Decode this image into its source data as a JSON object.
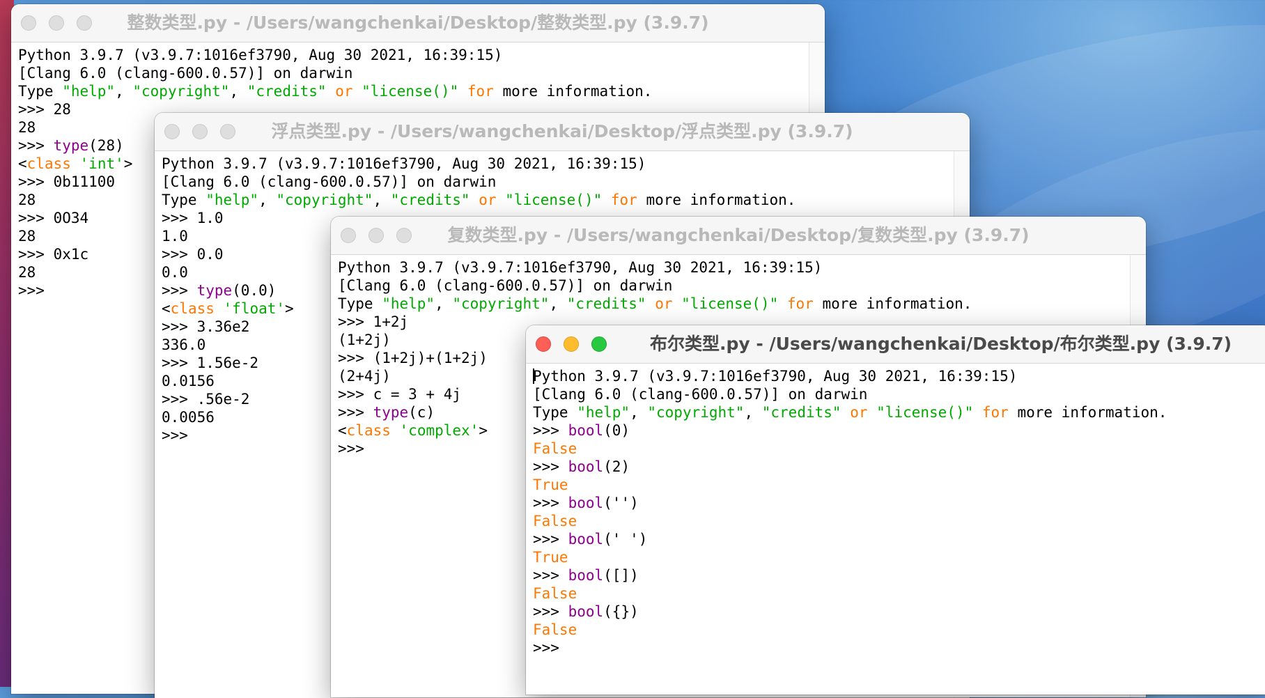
{
  "windows": [
    {
      "title": "整数类型.py - /Users/wangchenkai/Desktop/整数类型.py (3.9.7)",
      "lines": [
        [
          {
            "t": "Python 3.9.7 (v3.9.7:1016ef3790, Aug 30 2021, 16:39:15)",
            "c": ""
          }
        ],
        [
          {
            "t": "[Clang 6.0 (clang-600.0.57)] on darwin",
            "c": ""
          }
        ],
        [
          {
            "t": "Type ",
            "c": ""
          },
          {
            "t": "\"help\"",
            "c": "str"
          },
          {
            "t": ", ",
            "c": ""
          },
          {
            "t": "\"copyright\"",
            "c": "str"
          },
          {
            "t": ", ",
            "c": ""
          },
          {
            "t": "\"credits\"",
            "c": "str"
          },
          {
            "t": " ",
            "c": ""
          },
          {
            "t": "or",
            "c": "kw"
          },
          {
            "t": " ",
            "c": ""
          },
          {
            "t": "\"license()\"",
            "c": "str"
          },
          {
            "t": " ",
            "c": ""
          },
          {
            "t": "for",
            "c": "kw"
          },
          {
            "t": " more information.",
            "c": ""
          }
        ],
        [
          {
            "t": ">>> 28",
            "c": ""
          }
        ],
        [
          {
            "t": "28",
            "c": ""
          }
        ],
        [
          {
            "t": ">>> ",
            "c": ""
          },
          {
            "t": "type",
            "c": "bi"
          },
          {
            "t": "(28)",
            "c": ""
          }
        ],
        [
          {
            "t": "<",
            "c": ""
          },
          {
            "t": "class",
            "c": "kw"
          },
          {
            "t": " ",
            "c": ""
          },
          {
            "t": "'int'",
            "c": "str"
          },
          {
            "t": ">",
            "c": ""
          }
        ],
        [
          {
            "t": ">>> 0b11100",
            "c": ""
          }
        ],
        [
          {
            "t": "28",
            "c": ""
          }
        ],
        [
          {
            "t": ">>> 0O34",
            "c": ""
          }
        ],
        [
          {
            "t": "28",
            "c": ""
          }
        ],
        [
          {
            "t": ">>> 0x1c",
            "c": ""
          }
        ],
        [
          {
            "t": "28",
            "c": ""
          }
        ],
        [
          {
            "t": ">>>",
            "c": ""
          }
        ]
      ]
    },
    {
      "title": "浮点类型.py - /Users/wangchenkai/Desktop/浮点类型.py (3.9.7)",
      "lines": [
        [
          {
            "t": "Python 3.9.7 (v3.9.7:1016ef3790, Aug 30 2021, 16:39:15)",
            "c": ""
          }
        ],
        [
          {
            "t": "[Clang 6.0 (clang-600.0.57)] on darwin",
            "c": ""
          }
        ],
        [
          {
            "t": "Type ",
            "c": ""
          },
          {
            "t": "\"help\"",
            "c": "str"
          },
          {
            "t": ", ",
            "c": ""
          },
          {
            "t": "\"copyright\"",
            "c": "str"
          },
          {
            "t": ", ",
            "c": ""
          },
          {
            "t": "\"credits\"",
            "c": "str"
          },
          {
            "t": " ",
            "c": ""
          },
          {
            "t": "or",
            "c": "kw"
          },
          {
            "t": " ",
            "c": ""
          },
          {
            "t": "\"license()\"",
            "c": "str"
          },
          {
            "t": " ",
            "c": ""
          },
          {
            "t": "for",
            "c": "kw"
          },
          {
            "t": " more information.",
            "c": ""
          }
        ],
        [
          {
            "t": ">>> 1.0",
            "c": ""
          }
        ],
        [
          {
            "t": "1.0",
            "c": ""
          }
        ],
        [
          {
            "t": ">>> 0.0",
            "c": ""
          }
        ],
        [
          {
            "t": "0.0",
            "c": ""
          }
        ],
        [
          {
            "t": ">>> ",
            "c": ""
          },
          {
            "t": "type",
            "c": "bi"
          },
          {
            "t": "(0.0)",
            "c": ""
          }
        ],
        [
          {
            "t": "<",
            "c": ""
          },
          {
            "t": "class",
            "c": "kw"
          },
          {
            "t": " ",
            "c": ""
          },
          {
            "t": "'float'",
            "c": "str"
          },
          {
            "t": ">",
            "c": ""
          }
        ],
        [
          {
            "t": ">>> 3.36e2",
            "c": ""
          }
        ],
        [
          {
            "t": "336.0",
            "c": ""
          }
        ],
        [
          {
            "t": ">>> 1.56e-2",
            "c": ""
          }
        ],
        [
          {
            "t": "0.0156",
            "c": ""
          }
        ],
        [
          {
            "t": ">>> .56e-2",
            "c": ""
          }
        ],
        [
          {
            "t": "0.0056",
            "c": ""
          }
        ],
        [
          {
            "t": ">>>",
            "c": ""
          }
        ]
      ]
    },
    {
      "title": "复数类型.py - /Users/wangchenkai/Desktop/复数类型.py (3.9.7)",
      "lines": [
        [
          {
            "t": "Python 3.9.7 (v3.9.7:1016ef3790, Aug 30 2021, 16:39:15)",
            "c": ""
          }
        ],
        [
          {
            "t": "[Clang 6.0 (clang-600.0.57)] on darwin",
            "c": ""
          }
        ],
        [
          {
            "t": "Type ",
            "c": ""
          },
          {
            "t": "\"help\"",
            "c": "str"
          },
          {
            "t": ", ",
            "c": ""
          },
          {
            "t": "\"copyright\"",
            "c": "str"
          },
          {
            "t": ", ",
            "c": ""
          },
          {
            "t": "\"credits\"",
            "c": "str"
          },
          {
            "t": " ",
            "c": ""
          },
          {
            "t": "or",
            "c": "kw"
          },
          {
            "t": " ",
            "c": ""
          },
          {
            "t": "\"license()\"",
            "c": "str"
          },
          {
            "t": " ",
            "c": ""
          },
          {
            "t": "for",
            "c": "kw"
          },
          {
            "t": " more information.",
            "c": ""
          }
        ],
        [
          {
            "t": ">>> 1+2j",
            "c": ""
          }
        ],
        [
          {
            "t": "(1+2j)",
            "c": ""
          }
        ],
        [
          {
            "t": ">>> (1+2j)+(1+2j)",
            "c": ""
          }
        ],
        [
          {
            "t": "(2+4j)",
            "c": ""
          }
        ],
        [
          {
            "t": ">>> c = 3 + 4j",
            "c": ""
          }
        ],
        [
          {
            "t": ">>> ",
            "c": ""
          },
          {
            "t": "type",
            "c": "bi"
          },
          {
            "t": "(c)",
            "c": ""
          }
        ],
        [
          {
            "t": "<",
            "c": ""
          },
          {
            "t": "class",
            "c": "kw"
          },
          {
            "t": " ",
            "c": ""
          },
          {
            "t": "'complex'",
            "c": "str"
          },
          {
            "t": ">",
            "c": ""
          }
        ],
        [
          {
            "t": ">>>",
            "c": ""
          }
        ]
      ]
    },
    {
      "title": "布尔类型.py - /Users/wangchenkai/Desktop/布尔类型.py (3.9.7)",
      "lines": [
        [
          {
            "t": "Python 3.9.7 (v3.9.7:1016ef3790, Aug 30 2021, 16:39:15)",
            "c": ""
          }
        ],
        [
          {
            "t": "[Clang 6.0 (clang-600.0.57)] on darwin",
            "c": ""
          }
        ],
        [
          {
            "t": "Type ",
            "c": ""
          },
          {
            "t": "\"help\"",
            "c": "str"
          },
          {
            "t": ", ",
            "c": ""
          },
          {
            "t": "\"copyright\"",
            "c": "str"
          },
          {
            "t": ", ",
            "c": ""
          },
          {
            "t": "\"credits\"",
            "c": "str"
          },
          {
            "t": " ",
            "c": ""
          },
          {
            "t": "or",
            "c": "kw"
          },
          {
            "t": " ",
            "c": ""
          },
          {
            "t": "\"license()\"",
            "c": "str"
          },
          {
            "t": " ",
            "c": ""
          },
          {
            "t": "for",
            "c": "kw"
          },
          {
            "t": " more information.",
            "c": ""
          }
        ],
        [
          {
            "t": ">>> ",
            "c": ""
          },
          {
            "t": "bool",
            "c": "bi"
          },
          {
            "t": "(0)",
            "c": ""
          }
        ],
        [
          {
            "t": "False",
            "c": "out"
          }
        ],
        [
          {
            "t": ">>> ",
            "c": ""
          },
          {
            "t": "bool",
            "c": "bi"
          },
          {
            "t": "(2)",
            "c": ""
          }
        ],
        [
          {
            "t": "True",
            "c": "out"
          }
        ],
        [
          {
            "t": ">>> ",
            "c": ""
          },
          {
            "t": "bool",
            "c": "bi"
          },
          {
            "t": "('')",
            "c": ""
          }
        ],
        [
          {
            "t": "False",
            "c": "out"
          }
        ],
        [
          {
            "t": ">>> ",
            "c": ""
          },
          {
            "t": "bool",
            "c": "bi"
          },
          {
            "t": "(' ')",
            "c": ""
          }
        ],
        [
          {
            "t": "True",
            "c": "out"
          }
        ],
        [
          {
            "t": ">>> ",
            "c": ""
          },
          {
            "t": "bool",
            "c": "bi"
          },
          {
            "t": "([])",
            "c": ""
          }
        ],
        [
          {
            "t": "False",
            "c": "out"
          }
        ],
        [
          {
            "t": ">>> ",
            "c": ""
          },
          {
            "t": "bool",
            "c": "bi"
          },
          {
            "t": "({})",
            "c": ""
          }
        ],
        [
          {
            "t": "False",
            "c": "out"
          }
        ],
        [
          {
            "t": ">>>",
            "c": ""
          }
        ]
      ]
    }
  ],
  "syntax_colors": {
    "keyword": "#ff7700",
    "string": "#00aa00",
    "builtin": "#900090",
    "output": "#ff7700"
  },
  "traffic_lights": {
    "close": "#fe5f57",
    "minimize": "#febc2e",
    "zoom": "#28c840"
  }
}
